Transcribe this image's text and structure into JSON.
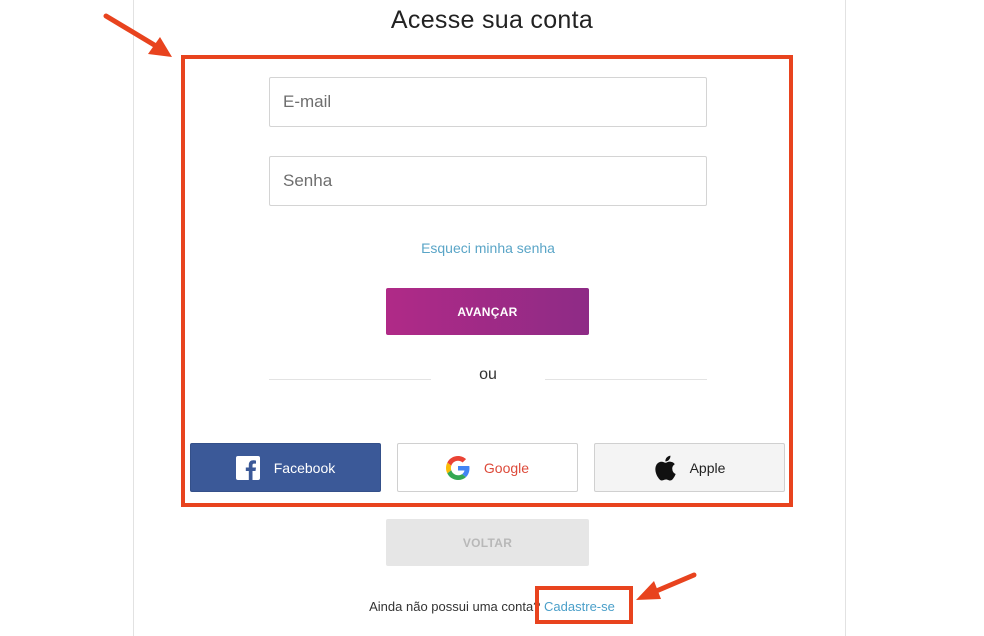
{
  "title": "Acesse sua conta",
  "form": {
    "email_placeholder": "E-mail",
    "password_placeholder": "Senha",
    "forgot_password": "Esqueci minha senha",
    "submit_label": "AVANÇAR",
    "divider_text": "ou"
  },
  "social": {
    "facebook_label": "Facebook",
    "google_label": "Google",
    "apple_label": "Apple"
  },
  "back_label": "VOLTAR",
  "signup": {
    "prompt": "Ainda não possui uma conta?",
    "link": "Cadastre-se"
  },
  "colors": {
    "accent_gradient_start": "#b02a87",
    "accent_gradient_end": "#8e2b86",
    "link": "#5aa5c7",
    "facebook": "#3b5998",
    "google_text": "#dd4a3a",
    "annotation": "#e8431e"
  }
}
